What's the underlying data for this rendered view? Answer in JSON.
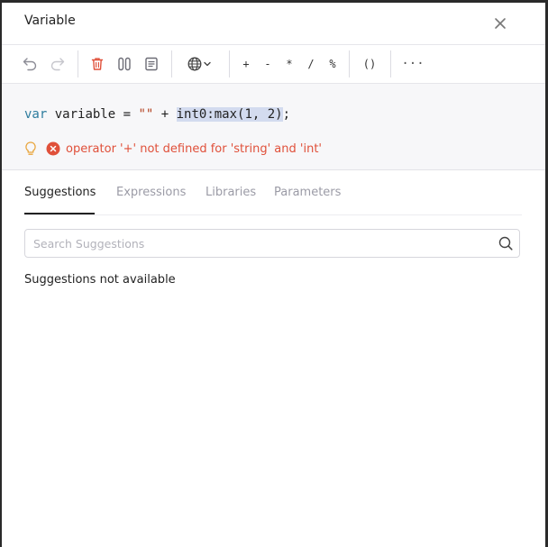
{
  "dialog": {
    "title": "Variable"
  },
  "toolbar": {
    "operators": [
      "+",
      "-",
      "*",
      "/",
      "%"
    ],
    "parens": "()",
    "more": "···"
  },
  "editor": {
    "code": {
      "keyword": "var",
      "name": " variable = ",
      "string": "\"\"",
      "plus": " + ",
      "selected": "int0:max(1, 2)",
      "end": ";"
    },
    "error": "operator '+' not defined for 'string' and 'int'"
  },
  "tabs": [
    "Suggestions",
    "Expressions",
    "Libraries",
    "Parameters"
  ],
  "search": {
    "placeholder": "Search Suggestions",
    "value": ""
  },
  "suggestions": {
    "empty_message": "Suggestions not available"
  },
  "colors": {
    "error": "#e0503a",
    "keyword": "#2d7c9e",
    "string": "#b3401f",
    "selection": "#d3dbef",
    "hint": "#e8a43a"
  }
}
